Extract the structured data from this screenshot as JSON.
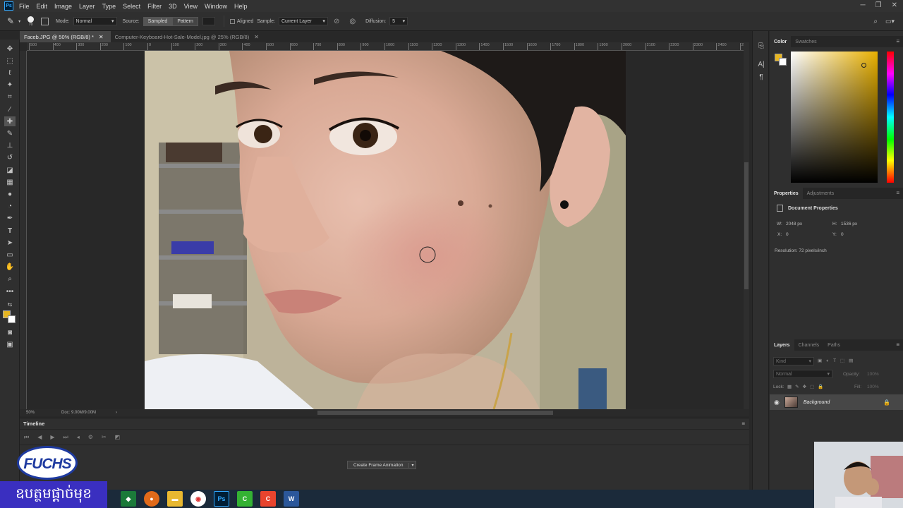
{
  "app": {
    "logo": "Ps"
  },
  "menu": [
    "File",
    "Edit",
    "Image",
    "Layer",
    "Type",
    "Select",
    "Filter",
    "3D",
    "View",
    "Window",
    "Help"
  ],
  "options": {
    "brush_size": "70",
    "mode_label": "Mode:",
    "mode_value": "Normal",
    "source_label": "Source:",
    "sampled": "Sampled",
    "pattern": "Pattern",
    "aligned": "Aligned",
    "sample_label": "Sample:",
    "sample_value": "Current Layer",
    "diffusion_label": "Diffusion:",
    "diffusion_value": "5"
  },
  "tabs": [
    {
      "label": "Faceb.JPG @ 50% (RGB/8) *",
      "active": true
    },
    {
      "label": "Computer-Keyboard-Hot-Sale-Model.jpg @ 25% (RGB/8)",
      "active": false
    }
  ],
  "ruler_ticks": [
    "500",
    "400",
    "300",
    "200",
    "100",
    "0",
    "100",
    "200",
    "300",
    "400",
    "500",
    "600",
    "700",
    "800",
    "900",
    "1000",
    "1100",
    "1200",
    "1300",
    "1400",
    "1500",
    "1600",
    "1700",
    "1800",
    "1900",
    "2000",
    "2100",
    "2200",
    "2300",
    "2400",
    "2500"
  ],
  "status": {
    "zoom": "50%",
    "doc": "Doc: 9.00M/9.00M"
  },
  "timeline": {
    "title": "Timeline",
    "create_button": "Create Frame Animation"
  },
  "color_panel": {
    "tabs": [
      "Color",
      "Swatches"
    ],
    "foreground": "#e8b620",
    "background": "#ffffff"
  },
  "properties": {
    "tabs": [
      "Properties",
      "Adjustments"
    ],
    "title": "Document Properties",
    "w_label": "W:",
    "w_value": "2048 px",
    "h_label": "H:",
    "h_value": "1536 px",
    "x_label": "X:",
    "x_value": "0",
    "y_label": "Y:",
    "y_value": "0",
    "resolution": "Resolution: 72 pixels/inch"
  },
  "layers": {
    "tabs": [
      "Layers",
      "Channels",
      "Paths"
    ],
    "kind": "Kind",
    "blend": "Normal",
    "opacity_label": "Opacity:",
    "opacity_value": "100%",
    "lock_label": "Lock:",
    "fill_label": "Fill:",
    "fill_value": "100%",
    "layer_name": "Background"
  },
  "overlay": {
    "brand": "FUCHS",
    "khmer": "ឧបត្ថមផ្ដាច់មុខ"
  }
}
